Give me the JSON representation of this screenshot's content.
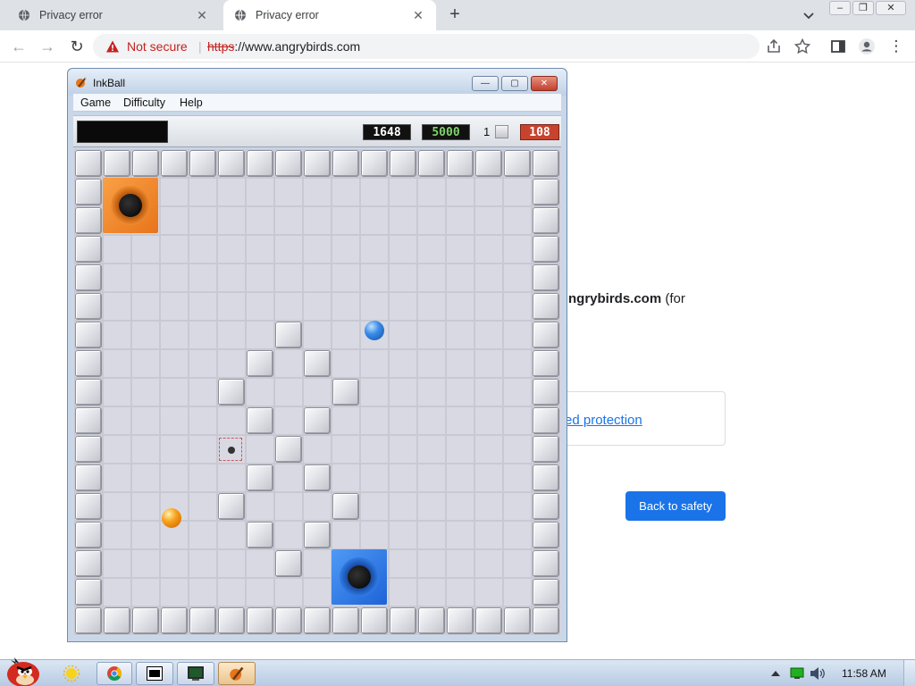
{
  "browser": {
    "tabs": [
      {
        "title": "Privacy error",
        "close": "✕"
      },
      {
        "title": "Privacy error",
        "close": "✕"
      }
    ],
    "new_tab": "+",
    "window_controls": [
      "–",
      "❐",
      "✕"
    ],
    "security": {
      "label": "Not secure",
      "separator": "|"
    },
    "url": {
      "scheme": "https",
      "rest": "://www.angrybirds.com"
    },
    "nav": {
      "back": "←",
      "forward": "→",
      "reload": "↻"
    },
    "menu": "⋮"
  },
  "page": {
    "domain_bold": "ngrybirds.com",
    "domain_rest": " (for",
    "link_text": "ed protection",
    "back_to_safety": "Back to safety"
  },
  "inkball": {
    "title": "InkBall",
    "window_buttons": [
      "—",
      "▢",
      "✕"
    ],
    "menu": [
      "Game",
      "Difficulty",
      "Help"
    ],
    "score": "1648",
    "target": "5000",
    "level": "1",
    "timer": "108"
  },
  "taskbar": {
    "clock": "11:58 AM"
  },
  "colors": {
    "not_secure": "#c5221f",
    "link": "#1a73e8",
    "target_counter": "#7fd36b",
    "timer_bg": "#c8432e",
    "hole_orange": "#e8741a",
    "hole_blue": "#1d63d8"
  },
  "icons": [
    "globe-icon",
    "warning-triangle-icon",
    "share-icon",
    "star-icon",
    "sidebar-icon",
    "profile-icon",
    "chevron-down-icon",
    "inkball-app-icon",
    "angry-bird-icon",
    "sun-icon",
    "chrome-icon",
    "7zip-icon",
    "terminal-icon",
    "network-icon",
    "volume-icon",
    "show-desktop-icon"
  ]
}
